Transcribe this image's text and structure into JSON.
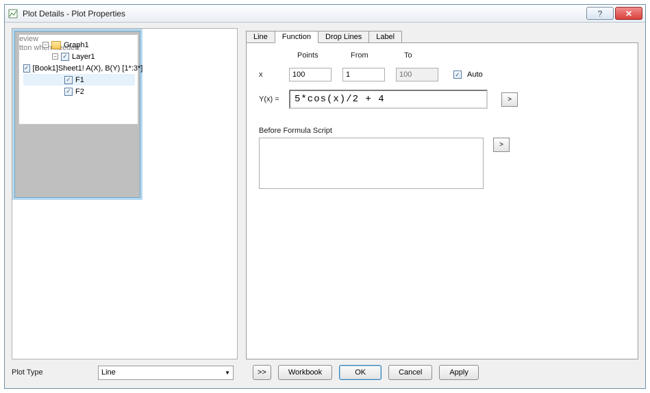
{
  "window": {
    "title": "Plot Details - Plot Properties",
    "help_glyph": "?",
    "close_glyph": "✕"
  },
  "ghost": {
    "line1": "eview",
    "line2": "tton when needed."
  },
  "tree": {
    "graph": "Graph1",
    "layer": "Layer1",
    "items": [
      {
        "label": "[Book1]Sheet1! A(X), B(Y) [1*:3*]"
      },
      {
        "label": "F1"
      },
      {
        "label": "F2"
      }
    ]
  },
  "tabs": {
    "line": "Line",
    "function": "Function",
    "drop": "Drop Lines",
    "label": "Label"
  },
  "fn": {
    "points_head": "Points",
    "from_head": "From",
    "to_head": "To",
    "xvar": "x",
    "points": "100",
    "from": "1",
    "to": "100",
    "auto": "Auto",
    "yx": "Y(x) =",
    "formula": "5*cos(x)/2 + 4",
    "before": "Before Formula Script",
    "more": ">"
  },
  "bottom": {
    "plot_type_label": "Plot Type",
    "plot_type_value": "Line",
    "expand": ">>",
    "workbook": "Workbook",
    "ok": "OK",
    "cancel": "Cancel",
    "apply": "Apply"
  }
}
